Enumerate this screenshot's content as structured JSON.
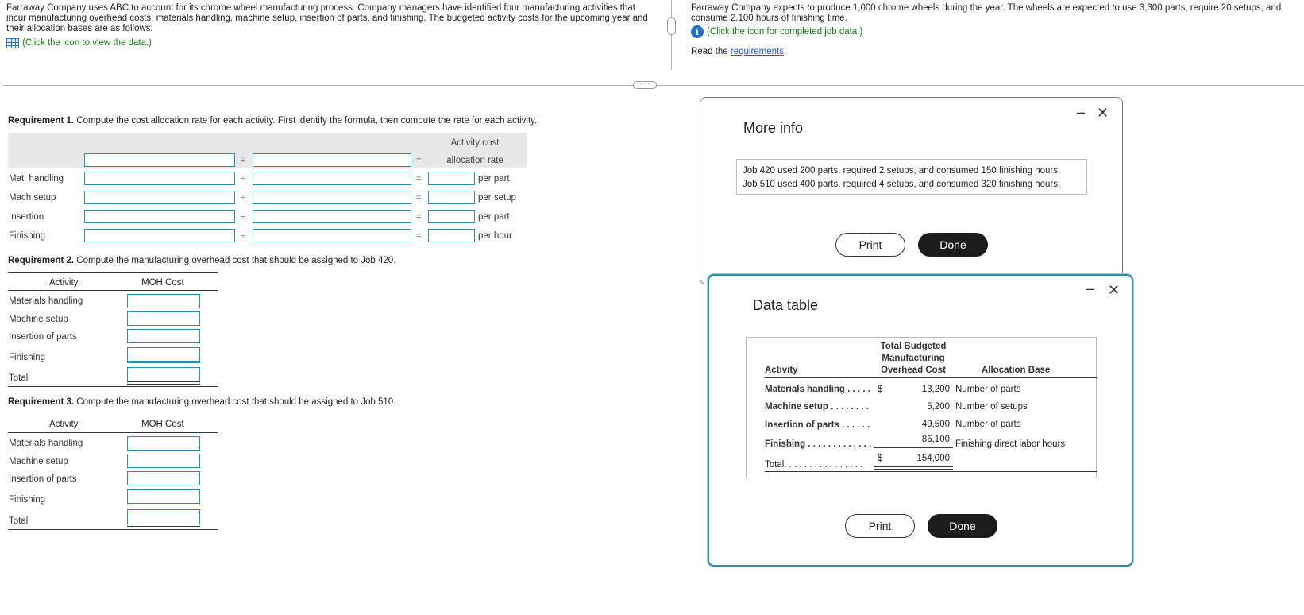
{
  "intro": {
    "left_text": "Farraway Company uses ABC to account for its chrome wheel manufacturing process. Company managers have identified four manufacturing activities that incur manufacturing overhead costs: materials handling, machine setup, insertion of parts, and finishing. The budgeted activity costs for the upcoming year and their allocation bases are as follows:",
    "left_link": "(Click the icon to view the data.)",
    "right_text": "Farraway Company expects to produce 1,000 chrome wheels during the year. The wheels are expected to use 3,300 parts, require 20 setups, and consume 2,100 hours of finishing time.",
    "right_link": "(Click the icon for completed job data.)",
    "read_prefix": "Read the ",
    "read_link": "requirements",
    "read_suffix": "."
  },
  "req1": {
    "label": "Requirement 1.",
    "text": " Compute the cost allocation rate for each activity. First identify the formula, then compute the rate for each activity.",
    "header_line1": "Activity cost",
    "header_line2": "allocation rate",
    "div_symbol": "÷",
    "eq_symbol": "=",
    "rows": [
      {
        "label": "Mat. handling",
        "unit": "per part"
      },
      {
        "label": "Mach setup",
        "unit": "per setup"
      },
      {
        "label": "Insertion",
        "unit": "per part"
      },
      {
        "label": "Finishing",
        "unit": "per hour"
      }
    ]
  },
  "req2": {
    "label": "Requirement 2.",
    "text": " Compute the manufacturing overhead cost that should be assigned to Job 420.",
    "col_activity": "Activity",
    "col_moh": "MOH Cost",
    "rows": [
      "Materials handling",
      "Machine setup",
      "Insertion of parts",
      "Finishing",
      "Total"
    ]
  },
  "req3": {
    "label": "Requirement 3.",
    "text": " Compute the manufacturing overhead cost that should be assigned to Job 510.",
    "col_activity": "Activity",
    "col_moh": "MOH Cost",
    "rows": [
      "Materials handling",
      "Machine setup",
      "Insertion of parts",
      "Finishing",
      "Total"
    ]
  },
  "more_info": {
    "title": "More info",
    "line1": "Job 420 used 200 parts, required 2 setups, and consumed 150 finishing hours.",
    "line2": "Job 510 used 400 parts, required 4 setups, and consumed 320 finishing hours.",
    "print": "Print",
    "done": "Done",
    "minimize": "–",
    "close": "✕"
  },
  "data_table": {
    "title": "Data table",
    "header_cost_l1": "Total Budgeted",
    "header_cost_l2": "Manufacturing",
    "header_cost_l3": "Overhead Cost",
    "header_activity": "Activity",
    "header_base": "Allocation Base",
    "rows": [
      {
        "activity": "Materials handling . . . . .",
        "currency": "$",
        "cost": "13,200",
        "base": "Number of parts"
      },
      {
        "activity": "Machine setup . . . . . . . .",
        "currency": "",
        "cost": "5,200",
        "base": "Number of setups"
      },
      {
        "activity": "Insertion of parts . . . . . .",
        "currency": "",
        "cost": "49,500",
        "base": "Number of parts"
      },
      {
        "activity": "Finishing . . . . . . . . . . . . .",
        "currency": "",
        "cost": "86,100",
        "base": "Finishing direct labor hours"
      }
    ],
    "total_label": "Total. . . . . . . . . . . . . . . .",
    "total_currency": "$",
    "total_cost": "154,000",
    "print": "Print",
    "done": "Done",
    "minimize": "–",
    "close": "✕"
  },
  "colors": {
    "accent": "#2b8fa8",
    "link_green": "#1a7d1a",
    "link_blue": "#1a5ad6",
    "button_dark": "#1c1c1c"
  }
}
